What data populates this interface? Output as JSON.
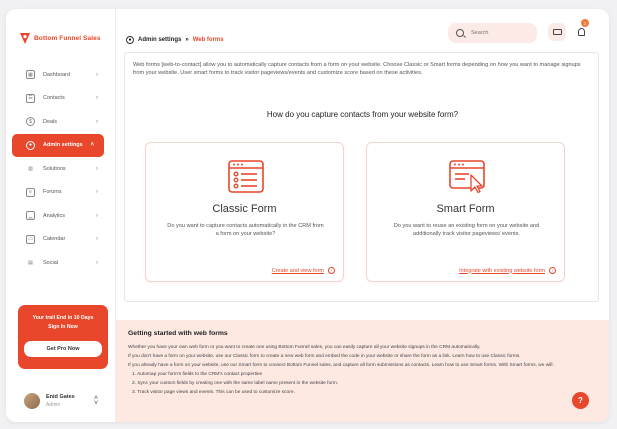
{
  "brand": {
    "name": "Bottom Funnel Sales",
    "accent": "#e8472b"
  },
  "sidebar": {
    "items": [
      {
        "label": "Dashboard",
        "icon": "dashboard-icon"
      },
      {
        "label": "Contacts",
        "icon": "contacts-icon"
      },
      {
        "label": "Deals",
        "icon": "deals-icon"
      },
      {
        "label": "Admin settings",
        "icon": "admin-settings-icon",
        "active": true
      },
      {
        "label": "Solutions",
        "icon": "solutions-icon"
      },
      {
        "label": "Forums",
        "icon": "forums-icon"
      },
      {
        "label": "Analytics",
        "icon": "analytics-icon"
      },
      {
        "label": "Calendar",
        "icon": "calendar-icon"
      },
      {
        "label": "Social",
        "icon": "social-icon"
      }
    ],
    "trial": {
      "line1": "Your trail End in 10 Days",
      "line2": "Sign In Now",
      "button": "Get Pro Now"
    },
    "user": {
      "name": "Enid Gates",
      "role": "Admin"
    }
  },
  "header": {
    "breadcrumb": {
      "parent": "Admin settings",
      "separator": "»",
      "current": "Web forms"
    },
    "search": {
      "placeholder": "Search"
    },
    "notifications_count": "1"
  },
  "main": {
    "intro": "Web forms [web-to-contact] allow you to automatically capture contacts from a form on your website. Choose Classic or Smart forms depending on how you want to manage signups from your website. User smart forms to track visitor pageviews/events and customize score based on these activities.",
    "question": "How do you capture contacts from your website form?",
    "cards": [
      {
        "title": "Classic Form",
        "description": "Do you want to capture contacts automatically in the CRM from a form on your website?",
        "link": "Create and view form",
        "icon": "classic-form-icon"
      },
      {
        "title": "Smart Form",
        "description": "Do you want to reuse an existing form on your website and additionally track visitor pageviews/ events.",
        "link": "Integrate with existing website form",
        "icon": "smart-form-icon"
      }
    ]
  },
  "getting_started": {
    "title": "Getting started with web forms",
    "lines": [
      "Whether you have your own web form or you want to create one using Bottom Funnel sales, you can easily capture all your website signups in the CRM automatically.",
      "If you don't have a form on your website, use our Classic form to create a new web form and embed the code in your website or share the form as a link. Learn how to use Classic forms.",
      "If you already have a form on your website, use our Smart form to connect Bottom Funnel sales, and capture all form submissions as contacts. Learn how to use Smart forms. With Smart forms, we will:",
      "1. Automap your form's fields to the CRM's contact properties",
      "2. Sync your custom fields by creating one with the same label name present in the website form.",
      "3. Track visitor page views and events. This can be used to customize score."
    ]
  },
  "help": "?"
}
